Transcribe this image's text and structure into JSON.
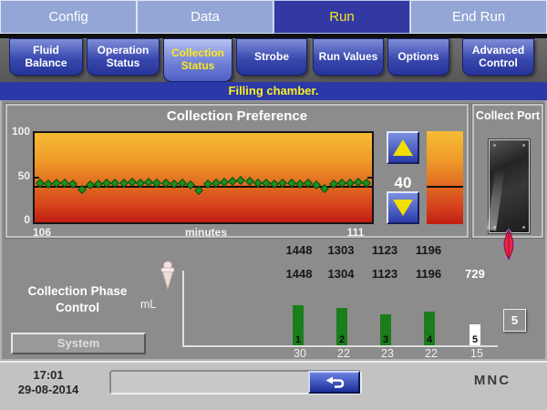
{
  "header": {
    "tabs": [
      {
        "label": "Config",
        "active": false
      },
      {
        "label": "Data",
        "active": false
      },
      {
        "label": "Run",
        "active": true
      },
      {
        "label": "End Run",
        "active": false
      }
    ],
    "subtabs": [
      {
        "label": "Fluid Balance",
        "active": false
      },
      {
        "label": "Operation Status",
        "active": false
      },
      {
        "label": "Collection Status",
        "active": true
      },
      {
        "label": "Strobe",
        "active": false
      },
      {
        "label": "Run Values",
        "active": false
      },
      {
        "label": "Options",
        "active": false
      },
      {
        "label": "Advanced Control",
        "active": false
      }
    ]
  },
  "status_message": "Filling chamber.",
  "collection_preference": {
    "title": "Collection Preference",
    "value": "40",
    "y_ticks": [
      "100",
      "50",
      "0"
    ],
    "x_start": "106",
    "x_axis_label": "minutes",
    "x_end": "111",
    "up_button": "up-arrow",
    "down_button": "down-arrow"
  },
  "collect_port": {
    "title": "Collect Port"
  },
  "phase": {
    "row1": [
      "1448",
      "1303",
      "1123",
      "1196"
    ],
    "row2": [
      "1448",
      "1304",
      "1123",
      "1196",
      "729"
    ],
    "title": "Collection Phase Control",
    "system_button": "System",
    "unit": "mL",
    "bar_numbers": [
      "1",
      "2",
      "3",
      "4",
      "5"
    ],
    "x_labels": [
      "30",
      "22",
      "23",
      "22",
      "15"
    ],
    "page_button": "5"
  },
  "footer": {
    "time": "17:01",
    "date": "29-08-2014",
    "procedure_label": "MNC"
  },
  "colors": {
    "status_bar_blue": "#2b38a8",
    "active_tab_blue": "#3239a2",
    "inactive_tab_blue": "#93a6d6",
    "highlight_yellow": "#f5e81e",
    "bar_green": "#1b7e1b",
    "marker_green": "#1f9020"
  },
  "chart_data": [
    {
      "type": "scatter",
      "title": "Collection Preference",
      "xlabel": "minutes",
      "ylabel": "",
      "ylim": [
        0,
        100
      ],
      "x_range_minutes": [
        106,
        111
      ],
      "setpoint": 40,
      "marker": "diamond",
      "marker_color": "#1f9020",
      "background": "thermal-gradient yellow→orange→red",
      "series": [
        {
          "name": "collection preference",
          "values": [
            44,
            43,
            44,
            44,
            43,
            37,
            42,
            43,
            44,
            44,
            44,
            45,
            44,
            45,
            44,
            44,
            43,
            44,
            42,
            36,
            43,
            44,
            45,
            46,
            47,
            46,
            44,
            44,
            43,
            44,
            44,
            43,
            44,
            42,
            38,
            43,
            44,
            44,
            45,
            44
          ]
        }
      ]
    },
    {
      "type": "bar",
      "title": "Collection Phase Control volumes",
      "ylabel": "mL",
      "categories": [
        "1",
        "2",
        "3",
        "4",
        "5"
      ],
      "x_tick_labels": [
        "30",
        "22",
        "23",
        "22",
        "15"
      ],
      "values_pct_of_axis": [
        55,
        51,
        42,
        46,
        29
      ],
      "bar_colors": [
        "#1b7e1b",
        "#1b7e1b",
        "#1b7e1b",
        "#1b7e1b",
        "#ffffff"
      ],
      "top_row_values": [
        1448,
        1303,
        1123,
        1196
      ],
      "second_row_values": [
        1448,
        1304,
        1123,
        1196,
        729
      ]
    }
  ]
}
